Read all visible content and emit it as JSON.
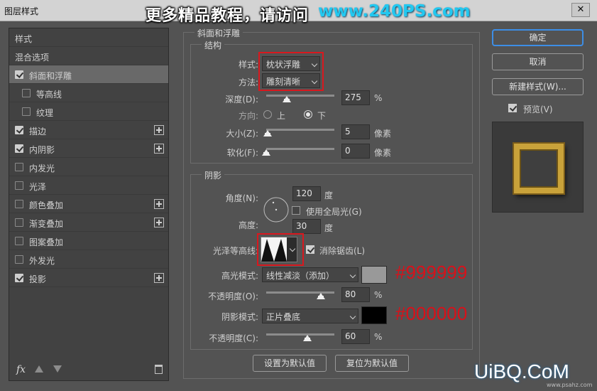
{
  "window": {
    "title": "图层样式",
    "close_glyph": "✕"
  },
  "watermark": {
    "headline": "更多精品教程，请访问",
    "site": "www.240PS.com",
    "logo": "UiBQ.CoM",
    "logo_sub": "www.psahz.com"
  },
  "left_panel": {
    "items": [
      {
        "label": "样式",
        "checkbox": false,
        "checked": false,
        "plus": false,
        "indent": false
      },
      {
        "label": "混合选项",
        "checkbox": false,
        "checked": false,
        "plus": false,
        "indent": false
      },
      {
        "label": "斜面和浮雕",
        "checkbox": true,
        "checked": true,
        "plus": false,
        "indent": false,
        "selected": true
      },
      {
        "label": "等高线",
        "checkbox": true,
        "checked": false,
        "plus": false,
        "indent": true
      },
      {
        "label": "纹理",
        "checkbox": true,
        "checked": false,
        "plus": false,
        "indent": true
      },
      {
        "label": "描边",
        "checkbox": true,
        "checked": true,
        "plus": true,
        "indent": false
      },
      {
        "label": "内阴影",
        "checkbox": true,
        "checked": true,
        "plus": true,
        "indent": false
      },
      {
        "label": "内发光",
        "checkbox": true,
        "checked": false,
        "plus": false,
        "indent": false
      },
      {
        "label": "光泽",
        "checkbox": true,
        "checked": false,
        "plus": false,
        "indent": false
      },
      {
        "label": "颜色叠加",
        "checkbox": true,
        "checked": false,
        "plus": true,
        "indent": false
      },
      {
        "label": "渐变叠加",
        "checkbox": true,
        "checked": false,
        "plus": true,
        "indent": false
      },
      {
        "label": "图案叠加",
        "checkbox": true,
        "checked": false,
        "plus": false,
        "indent": false
      },
      {
        "label": "外发光",
        "checkbox": true,
        "checked": false,
        "plus": false,
        "indent": false
      },
      {
        "label": "投影",
        "checkbox": true,
        "checked": true,
        "plus": true,
        "indent": false
      }
    ],
    "footer": {
      "fx_label": "fx"
    }
  },
  "bevel": {
    "section_title": "斜面和浮雕",
    "structure": {
      "title": "结构",
      "style_label": "样式:",
      "style_value": "枕状浮雕",
      "technique_label": "方法:",
      "technique_value": "雕刻清晰",
      "depth_label": "深度(D):",
      "depth_value": "275",
      "depth_unit": "%",
      "direction_label": "方向:",
      "dir_up": "上",
      "dir_down": "下",
      "size_label": "大小(Z):",
      "size_value": "5",
      "size_unit": "像素",
      "soften_label": "软化(F):",
      "soften_value": "0",
      "soften_unit": "像素"
    },
    "shading": {
      "title": "阴影",
      "angle_label": "角度(N):",
      "angle_value": "120",
      "angle_unit": "度",
      "global_light_label": "使用全局光(G)",
      "altitude_label": "高度:",
      "altitude_value": "30",
      "altitude_unit": "度",
      "gloss_label": "光泽等高线:",
      "antialias_label": "消除锯齿(L)",
      "highlight_label": "高光模式:",
      "highlight_value": "线性减淡（添加）",
      "highlight_color": "#999999",
      "highlight_color_text": "#999999",
      "hl_opacity_label": "不透明度(O):",
      "hl_opacity_value": "80",
      "hl_opacity_unit": "%",
      "shadow_label": "阴影模式:",
      "shadow_value": "正片叠底",
      "shadow_color": "#000000",
      "shadow_color_text": "#000000",
      "sh_opacity_label": "不透明度(C):",
      "sh_opacity_value": "60",
      "sh_opacity_unit": "%"
    },
    "make_default": "设置为默认值",
    "reset_default": "复位为默认值"
  },
  "right_panel": {
    "ok": "确定",
    "cancel": "取消",
    "new_style": "新建样式(W)...",
    "preview_label": "预览(V)"
  },
  "levels": {
    "depth": 0.3,
    "size": 0.02,
    "soften": 0.0,
    "hl_opacity": 0.8,
    "sh_opacity": 0.6
  }
}
